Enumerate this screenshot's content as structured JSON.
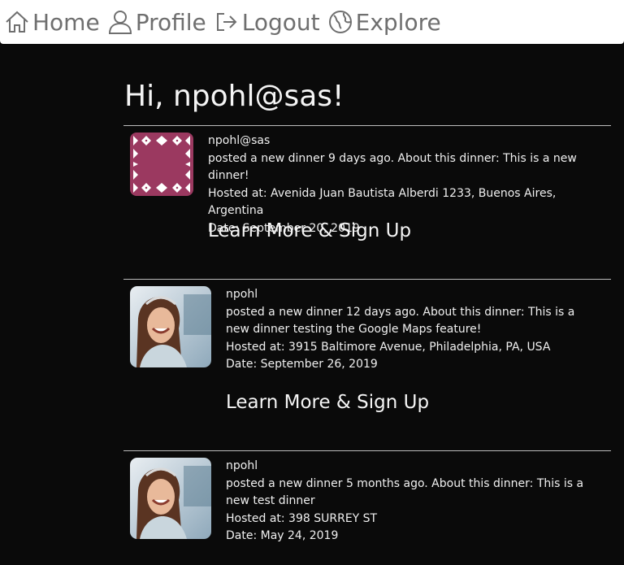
{
  "nav": {
    "items": [
      {
        "label": "Home",
        "icon": "home-icon"
      },
      {
        "label": "Profile",
        "icon": "profile-icon"
      },
      {
        "label": "Logout",
        "icon": "logout-icon"
      },
      {
        "label": "Explore",
        "icon": "globe-icon"
      }
    ]
  },
  "greeting": "Hi, npohl@sas!",
  "posts": [
    {
      "author": "npohl@sas",
      "description": "posted a new dinner 9 days ago. About this dinner: This is a new dinner!",
      "hosted": "Hosted at: Avenida Juan Bautista Alberdi 1233, Buenos Aires, Argentina",
      "date": "Date: September 20, 2019",
      "cta": "Learn More & Sign Up",
      "avatar_color": "#9b3960"
    },
    {
      "author": "npohl",
      "description": "posted a new dinner 12 days ago. About this dinner: This is a new dinner testing the Google Maps feature!",
      "hosted": "Hosted at: 3915 Baltimore Avenue, Philadelphia, PA, USA",
      "date": "Date: September 26, 2019",
      "cta": "Learn More & Sign Up"
    },
    {
      "author": "npohl",
      "description": "posted a new dinner 5 months ago. About this dinner: This is a new test dinner",
      "hosted": "Hosted at: 398 SURREY ST",
      "date": "Date: May 24, 2019"
    }
  ],
  "colors": {
    "background": "#0a0a0a",
    "navbar": "#ffffff",
    "nav_text": "#6f6f6f",
    "divider": "#bdbdbd"
  }
}
